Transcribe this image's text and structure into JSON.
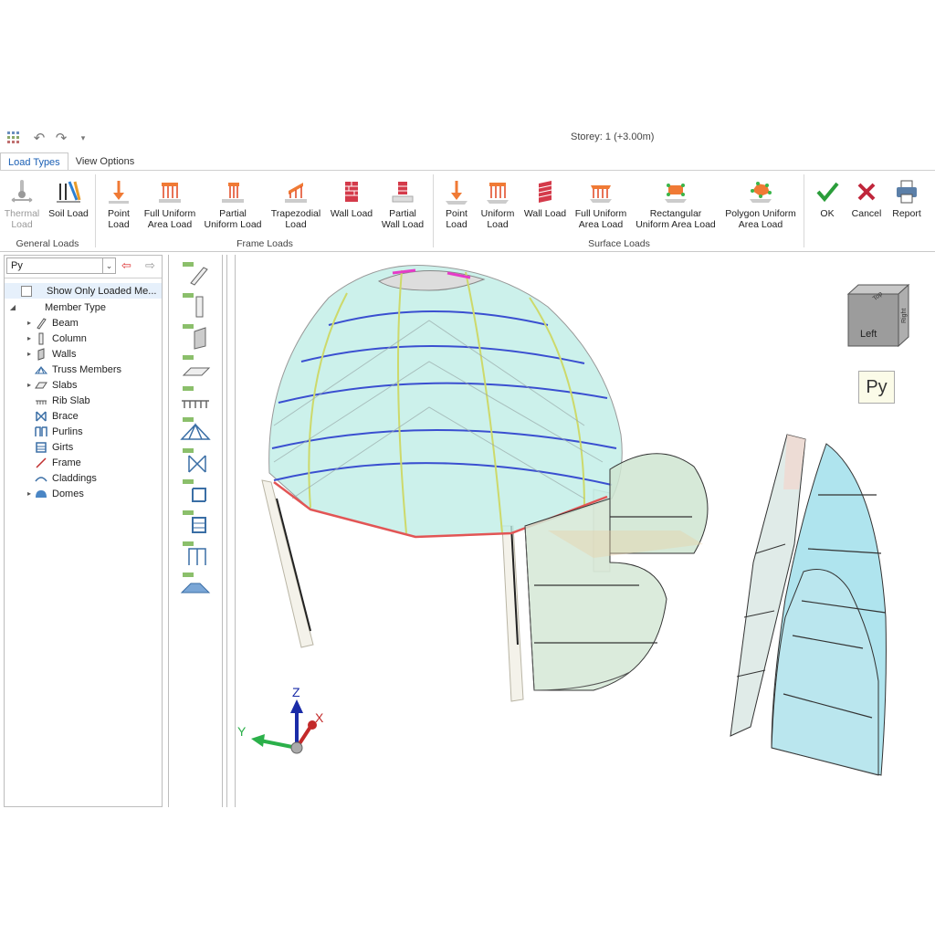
{
  "titlebar": {
    "title": "Storey: 1 (+3.00m)"
  },
  "tabs": [
    "Load Types",
    "View Options"
  ],
  "ribbon": {
    "general": {
      "label": "General Loads",
      "buttons": [
        {
          "line1": "Thermal",
          "line2": "Load"
        },
        {
          "line1": "Soil Load",
          "line2": ""
        }
      ]
    },
    "frame": {
      "label": "Frame Loads",
      "buttons": [
        {
          "line1": "Point",
          "line2": "Load"
        },
        {
          "line1": "Full Uniform",
          "line2": "Area Load"
        },
        {
          "line1": "Partial",
          "line2": "Uniform Load"
        },
        {
          "line1": "Trapezodial",
          "line2": "Load"
        },
        {
          "line1": "Wall Load",
          "line2": ""
        },
        {
          "line1": "Partial",
          "line2": "Wall Load"
        }
      ]
    },
    "surface": {
      "label": "Surface Loads",
      "buttons": [
        {
          "line1": "Point",
          "line2": "Load"
        },
        {
          "line1": "Uniform",
          "line2": "Load"
        },
        {
          "line1": "Wall Load",
          "line2": ""
        },
        {
          "line1": "Full Uniform",
          "line2": "Area Load"
        },
        {
          "line1": "Rectangular",
          "line2": "Uniform Area Load"
        },
        {
          "line1": "Polygon Uniform",
          "line2": "Area Load"
        }
      ]
    },
    "actions": {
      "ok": "OK",
      "cancel": "Cancel",
      "report": "Report"
    }
  },
  "tree": {
    "selector": "Py",
    "show_only_loaded": "Show Only Loaded Me...",
    "root": "Member Type",
    "items": [
      "Beam",
      "Column",
      "Walls",
      "Truss Members",
      "Slabs",
      "Rib Slab",
      "Brace",
      "Purlins",
      "Girts",
      "Frame",
      "Claddings",
      "Domes"
    ]
  },
  "viewport": {
    "cube_faces": {
      "top": "Top",
      "left": "Left",
      "right": "Right"
    },
    "load_label": "Py",
    "axes": {
      "x": "X",
      "y": "Y",
      "z": "Z"
    }
  },
  "colors": {
    "accent": "#1a5fb4",
    "ok_green": "#2a9d3a",
    "cancel_red": "#c0263b",
    "load_orange": "#f07a35"
  }
}
